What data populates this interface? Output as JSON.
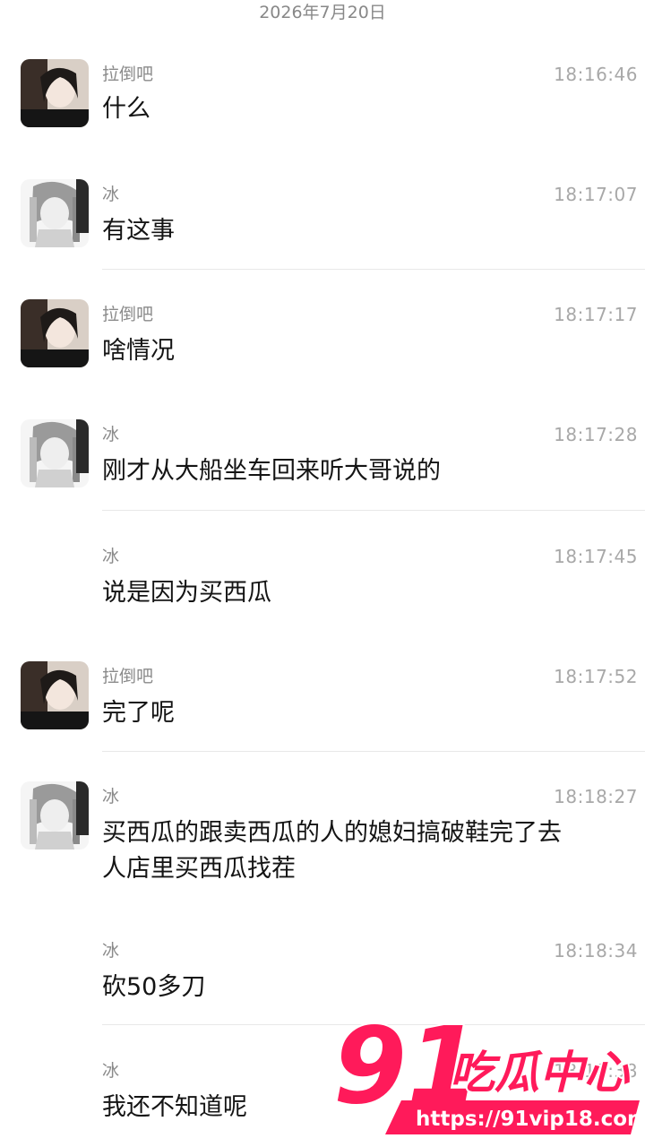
{
  "header": {
    "date": "2026年7月20日"
  },
  "messages": [
    {
      "sender": "拉倒吧",
      "time": "18:16:46",
      "text": "什么",
      "avatar": "avatar-girl"
    },
    {
      "sender": "冰",
      "time": "18:17:07",
      "text": "有这事",
      "avatar": "avatar-anime"
    },
    {
      "sender": "拉倒吧",
      "time": "18:17:17",
      "text": "啥情况",
      "avatar": "avatar-girl"
    },
    {
      "sender": "冰",
      "time": "18:17:28",
      "text": "刚才从大船坐车回来听大哥说的",
      "avatar": "avatar-anime"
    },
    {
      "sender": "冰",
      "time": "18:17:45",
      "text": "说是因为买西瓜",
      "avatar": ""
    },
    {
      "sender": "拉倒吧",
      "time": "18:17:52",
      "text": "完了呢",
      "avatar": "avatar-girl"
    },
    {
      "sender": "冰",
      "time": "18:18:27",
      "text_line1": "买西瓜的跟卖西瓜的人的媳妇搞破鞋完了去",
      "text_line2": "人店里买西瓜找茬",
      "avatar": "avatar-anime"
    },
    {
      "sender": "冰",
      "time": "18:18:34",
      "text": "砍50多刀",
      "avatar": ""
    },
    {
      "sender": "冰",
      "time": "18:18:38",
      "text": "我还不知道呢",
      "avatar": ""
    }
  ],
  "watermark": {
    "logo_number": "91",
    "logo_text": "吃瓜中心",
    "url": "https://91vip18.com",
    "color_brand": "#ff1a5a"
  },
  "icons": {
    "back": "chevron-left-icon"
  }
}
